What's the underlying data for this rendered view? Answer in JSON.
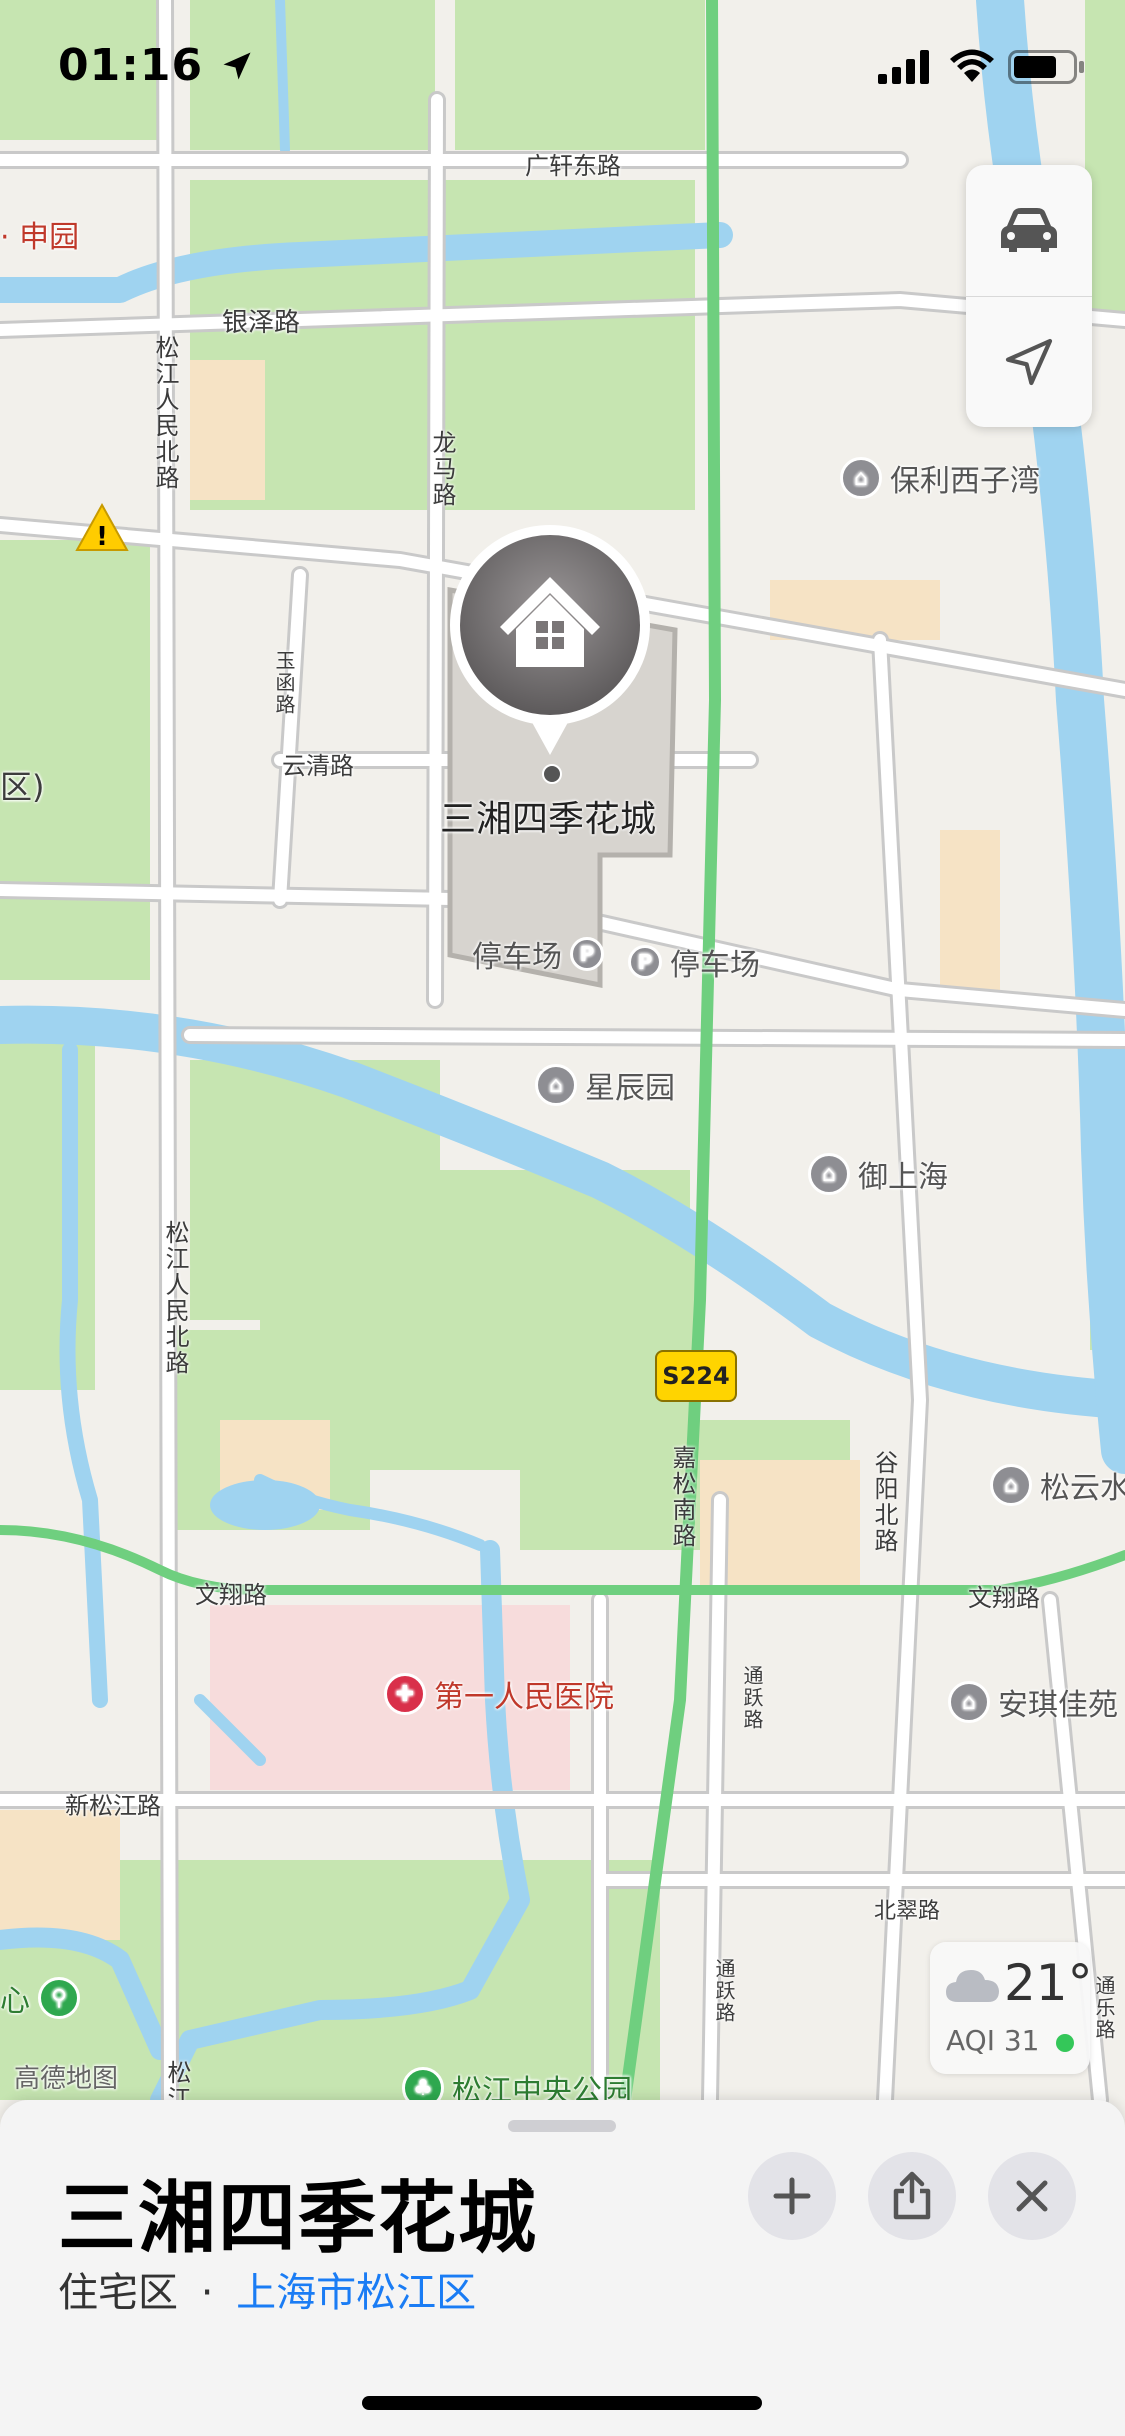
{
  "status_bar": {
    "time": "01:16"
  },
  "map": {
    "roads": {
      "guangxuan_east": "广轩东路",
      "yinze": "银泽路",
      "songjiang_renmin_north_a": "松江人民北路",
      "songjiang_renmin_north_b": "松江人民北路",
      "songjiang_renmin_north_c": "松江",
      "longma": "龙马路",
      "yuhan": "玉函路",
      "yunqing": "云清路",
      "wenxiang_a": "文翔路",
      "wenxiang_b": "文翔路",
      "jiasong_south": "嘉松南路",
      "guyang_north": "谷阳北路",
      "new_songjiang": "新松江路",
      "tongyue_a": "通跃路",
      "tongyue_b": "通跃路",
      "beicui": "北翠路",
      "tongqiao": "通乐路",
      "highway_badge": "S224"
    },
    "places": {
      "shenyuan": "申园",
      "district_fragment": "区)",
      "poly_xizi": "保利西子湾",
      "xingchen": "星辰园",
      "yushanghai": "御上海",
      "songyun": "松云水",
      "anqi": "安琪佳苑",
      "parking_a": "停车场",
      "parking_b": "停车场",
      "hospital": "第一人民医院",
      "park": "松江中央公园",
      "center_fragment": "心",
      "watermark": "高德地图"
    },
    "selected_pin": {
      "label": "三湘四季花城",
      "icon": "house-icon"
    }
  },
  "weather": {
    "temp": "21°",
    "aqi": "AQI 31",
    "aqi_color": "#34c759"
  },
  "sheet": {
    "title": "三湘四季花城",
    "category": "住宅区",
    "separator": "·",
    "location": "上海市松江区",
    "location_color": "#1a7cf4"
  },
  "colors": {
    "water": "#9fd3f0",
    "park": "#c6e5b1",
    "highway": "#6fcf7f"
  }
}
